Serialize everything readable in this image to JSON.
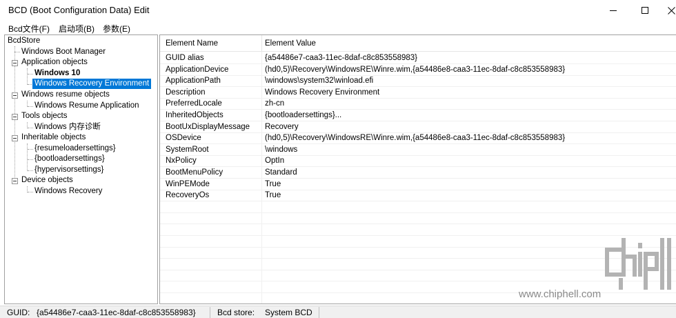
{
  "window": {
    "title": "BCD (Boot Configuration Data) Edit"
  },
  "menu": {
    "items": [
      "Bcd文件(F)",
      "启动项(B)",
      "参数(E)"
    ]
  },
  "tree": {
    "root": "BcdStore",
    "nodes": [
      "Windows Boot Manager",
      "Application objects",
      "Windows 10",
      "Windows Recovery Environment",
      "Windows resume objects",
      "Windows Resume Application",
      "Tools objects",
      "Windows 内存诊断",
      "Inheritable objects",
      "{resumeloadersettings}",
      "{bootloadersettings}",
      "{hypervisorsettings}",
      "Device objects",
      "Windows Recovery"
    ]
  },
  "list": {
    "headers": {
      "name": "Element Name",
      "value": "Element Value"
    },
    "rows": [
      {
        "name": "GUID alias",
        "value": "{a54486e7-caa3-11ec-8daf-c8c853558983}"
      },
      {
        "name": "ApplicationDevice",
        "value": "(hd0,5)\\Recovery\\WindowsRE\\Winre.wim,{a54486e8-caa3-11ec-8daf-c8c853558983}"
      },
      {
        "name": "ApplicationPath",
        "value": "\\windows\\system32\\winload.efi"
      },
      {
        "name": "Description",
        "value": "Windows Recovery Environment"
      },
      {
        "name": "PreferredLocale",
        "value": "zh-cn"
      },
      {
        "name": "InheritedObjects",
        "value": "{bootloadersettings}..."
      },
      {
        "name": "BootUxDisplayMessage",
        "value": "Recovery"
      },
      {
        "name": "OSDevice",
        "value": "(hd0,5)\\Recovery\\WindowsRE\\Winre.wim,{a54486e8-caa3-11ec-8daf-c8c853558983}"
      },
      {
        "name": "SystemRoot",
        "value": "\\windows"
      },
      {
        "name": "NxPolicy",
        "value": "OptIn"
      },
      {
        "name": "BootMenuPolicy",
        "value": "Standard"
      },
      {
        "name": "WinPEMode",
        "value": "True"
      },
      {
        "name": "RecoveryOs",
        "value": "True"
      }
    ]
  },
  "status": {
    "guid_label": "GUID:",
    "guid_value": "{a54486e7-caa3-11ec-8daf-c8c853558983}",
    "store_label": "Bcd store:",
    "store_value": "System BCD"
  },
  "watermark": {
    "logo": "chip hell",
    "url": "www.chiphell.com"
  }
}
